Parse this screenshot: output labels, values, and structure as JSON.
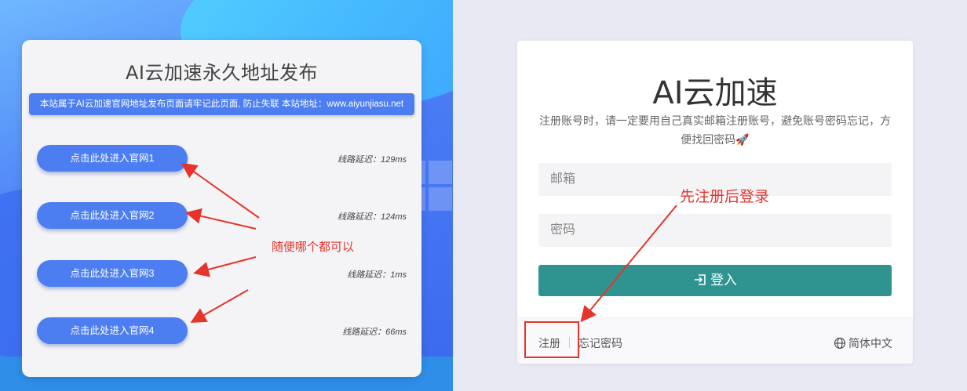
{
  "left_card": {
    "title": "AI云加速永久地址发布",
    "notice": "本站属于AI云加速官网地址发布页面请牢记此页面, 防止失联 本站地址：www.aiyunjiasu.net",
    "rows": [
      {
        "button": "点击此处进入官网1",
        "latency": "线路延迟：129ms"
      },
      {
        "button": "点击此处进入官网2",
        "latency": "线路延迟：124ms"
      },
      {
        "button": "点击此处进入官网3",
        "latency": "线路延迟：1ms"
      },
      {
        "button": "点击此处进入官网4",
        "latency": "线路延迟：66ms"
      }
    ]
  },
  "login": {
    "brand": "AI云加速",
    "hint": "注册账号时，请一定要用自己真实邮箱注册账号，避免账号密码忘记，方便找回密码🚀",
    "email_placeholder": "邮箱",
    "password_placeholder": "密码",
    "submit": "登入",
    "register": "注册",
    "forgot": "忘记密码",
    "language": "简体中文"
  },
  "annotations": {
    "left_note": "随便哪个都可以",
    "right_note": "先注册后登录"
  },
  "colors": {
    "accent_blue": "#4c7ef2",
    "submit_teal": "#2f9490",
    "annotation_red": "#e8332a"
  }
}
